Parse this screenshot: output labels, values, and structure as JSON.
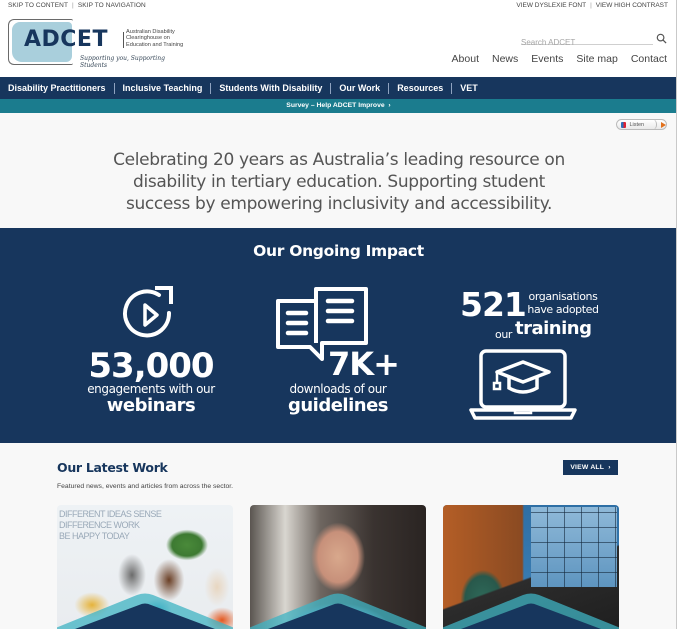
{
  "header": {
    "skip_links": [
      "SKIP TO CONTENT",
      "SKIP TO NAVIGATION"
    ],
    "accessibility_links": [
      "VIEW DYSLEXIE FONT",
      "VIEW HIGH CONTRAST"
    ],
    "logo": {
      "wordmark": "ADCET",
      "full_name": "Australian Disability Clearinghouse on Education and Training",
      "tagline": "Supporting you, Supporting Students",
      "accent_color": "#a9cfdc"
    },
    "search": {
      "placeholder": "Search ADCET",
      "value": "",
      "icon": "search-icon"
    },
    "top_nav": [
      "About",
      "News",
      "Events",
      "Site map",
      "Contact"
    ]
  },
  "main_nav": {
    "items": [
      "Disability Practitioners",
      "Inclusive Teaching",
      "Students With Disability",
      "Our Work",
      "Resources",
      "VET"
    ],
    "background": "#17365d"
  },
  "survey_bar": {
    "label": "Survey – Help ADCET Improve",
    "icon": "chevron-right-icon",
    "background": "#1b7c8e"
  },
  "listen_widget": {
    "label": "Listen",
    "icon": "speaker-icon",
    "play_icon": "play-icon"
  },
  "intro": {
    "text": "Celebrating 20 years as Australia’s leading resource on disability in tertiary education. Supporting student success by empowering inclusivity and accessibility."
  },
  "impact": {
    "title": "Our Ongoing Impact",
    "stats": [
      {
        "icon": "replay-video-icon",
        "number": "53,000",
        "description": "engagements with our",
        "emphasis": "webinars"
      },
      {
        "icon": "open-book-icon",
        "number": "7K+",
        "description": "downloads of our",
        "emphasis": "guidelines"
      },
      {
        "icon": "laptop-graduation-cap-icon",
        "number": "521",
        "description": "organisations have adopted",
        "prefix": "our",
        "emphasis": "training"
      }
    ]
  },
  "latest_work": {
    "title": "Our Latest Work",
    "subtitle": "Featured news, events and articles from across the sector.",
    "view_all_label": "VIEW ALL",
    "view_all_icon": "chevron-right-icon",
    "cards": [
      {
        "image": "group-discussion-photo",
        "wall_text": "DIFFERENT IDEAS SENSE\nDIFFERENCE WORK\nBE HAPPY TODAY"
      },
      {
        "image": "smiling-man-portrait-photo"
      },
      {
        "image": "video-conference-laptop-photo"
      }
    ]
  }
}
